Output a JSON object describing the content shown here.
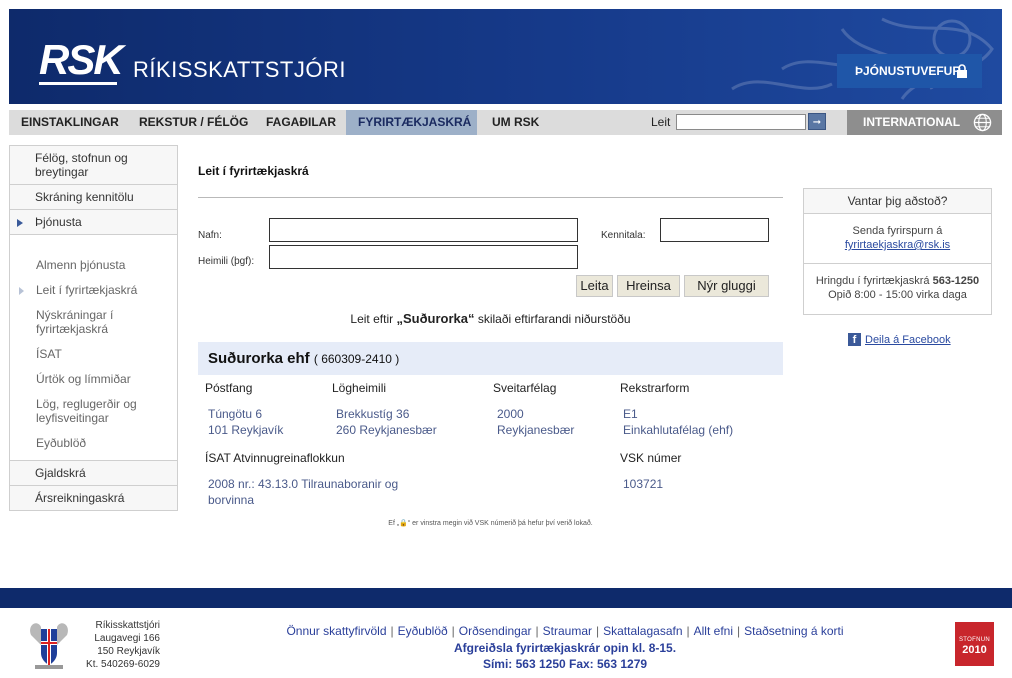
{
  "header": {
    "logo": "RSK",
    "title": "RÍKISSKATTSTJÓRI",
    "service_button": "ÞJÓNUSTUVEFUR"
  },
  "nav": {
    "items": [
      "EINSTAKLINGAR",
      "REKSTUR / FÉLÖG",
      "FAGAÐILAR",
      "FYRIRTÆKJASKRÁ",
      "UM RSK"
    ],
    "active": "FYRIRTÆKJASKRÁ",
    "search_label": "Leit",
    "search_value": "",
    "international": "INTERNATIONAL"
  },
  "sidebar": {
    "top_items": [
      "Félög, stofnun og breytingar",
      "Skráning kennitölu",
      "Þjónusta"
    ],
    "sub_items": [
      "Almenn þjónusta",
      "Leit í fyrirtækjaskrá",
      "Nýskráningar í fyrirtækjaskrá",
      "ÍSAT",
      "Úrtök og límmiðar",
      "Lög, reglugerðir og leyfisveitingar",
      "Eyðublöð"
    ],
    "bottom_items": [
      "Gjaldskrá",
      "Ársreikningaskrá"
    ]
  },
  "main": {
    "title": "Leit í fyrirtækjaskrá",
    "form": {
      "name_label": "Nafn:",
      "name_value": "",
      "kennitala_label": "Kennitala:",
      "kennitala_value": "",
      "address_label": "Heimili (þgf):",
      "address_value": "",
      "search_button": "Leita",
      "clear_button": "Hreinsa",
      "new_window_button": "Nýr gluggi"
    },
    "result_prefix": "Leit eftir",
    "result_term": "„Suðurorka“",
    "result_suffix": "skilaði eftirfarandi niðurstöðu",
    "company": {
      "name": "Suðurorka ehf",
      "kennitala": "( 660309-2410 )",
      "headers": [
        "Póstfang",
        "Lögheimili",
        "Sveitarfélag",
        "Rekstrarform"
      ],
      "postfang": [
        "Túngötu 6",
        "101 Reykjavík"
      ],
      "logheimili": [
        "Brekkustíg 36",
        "260 Reykjanesbær"
      ],
      "sveitarfelag": [
        "2000",
        "Reykjanesbær"
      ],
      "rekstrarform": [
        "E1",
        "Einkahlutafélag (ehf)"
      ],
      "isat_header": "ÍSAT Atvinnugreinaflokkun",
      "isat_value": [
        "2008 nr.: 43.13.0 Tilraunaboranir og",
        "borvinna"
      ],
      "vsk_header": "VSK númer",
      "vsk_value": "103721"
    },
    "lock_note_pre": "Ef „",
    "lock_note_post": "“ er vinstra megin við VSK númerið þá hefur því verið lokað."
  },
  "help": {
    "title": "Vantar þig aðstoð?",
    "send_text": "Senda fyrirspurn á",
    "email": "fyrirtaekjaskra@rsk.is",
    "call_text": "Hringdu í fyrirtækjaskrá",
    "phone": "563-1250",
    "hours": "Opið 8:00 - 15:00 virka daga",
    "facebook": "Deila á Facebook"
  },
  "footer": {
    "address": [
      "Ríkisskattstjóri",
      "Laugavegi 166",
      "150 Reykjavík",
      "Kt. 540269-6029"
    ],
    "links": [
      "Önnur skattyfirvöld",
      "Eyðublöð",
      "Orðsendingar",
      "Straumar",
      "Skattalagasafn",
      "Allt efni",
      "Staðsetning á korti"
    ],
    "opening": "Afgreiðsla fyrirtækjaskrár opin kl. 8-15.",
    "phone": "Sími: 563 1250   Fax: 563 1279",
    "stamp_text": "STOFNUN",
    "stamp_year": "2010"
  },
  "colors": {
    "header_blue": "#0e2a6b",
    "accent_blue": "#1f56a8",
    "nav_gray": "#dcdcdc",
    "active_tab": "#9db0c8",
    "company_bar": "#e6ecf8",
    "stamp_red": "#c8262c"
  }
}
